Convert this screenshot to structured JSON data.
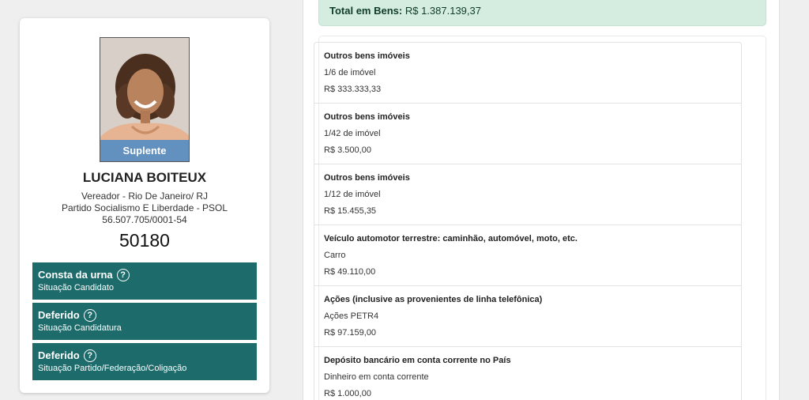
{
  "candidate": {
    "badge": "Suplente",
    "name": "LUCIANA BOITEUX",
    "office": "Vereador - Rio De Janeiro/ RJ",
    "party": "Partido Socialismo E Liberdade - PSOL",
    "cnpj": "56.507.705/0001-54",
    "number": "50180"
  },
  "status_boxes": [
    {
      "title": "Consta da urna",
      "subtitle": "Situação Candidato"
    },
    {
      "title": "Deferido",
      "subtitle": "Situação Candidatura"
    },
    {
      "title": "Deferido",
      "subtitle": "Situação Partido/Federação/Coligação"
    }
  ],
  "help_glyph": "?",
  "total": {
    "label": "Total em Bens:",
    "value": "R$ 1.387.139,37"
  },
  "assets": [
    {
      "type": "Outros bens imóveis",
      "desc": "1/6 de imóvel",
      "value": "R$ 333.333,33"
    },
    {
      "type": "Outros bens imóveis",
      "desc": "1/42 de imóvel",
      "value": "R$ 3.500,00"
    },
    {
      "type": "Outros bens imóveis",
      "desc": "1/12 de imóvel",
      "value": "R$ 15.455,35"
    },
    {
      "type": "Veículo automotor terrestre: caminhão, automóvel, moto, etc.",
      "desc": "Carro",
      "value": "R$ 49.110,00"
    },
    {
      "type": "Ações (inclusive as provenientes de linha telefônica)",
      "desc": "Ações PETR4",
      "value": "R$ 97.159,00"
    },
    {
      "type": "Depósito bancário em conta corrente no País",
      "desc": "Dinheiro em conta corrente",
      "value": "R$ 1.000,00"
    }
  ],
  "colors": {
    "status_bg": "#1e6b6b",
    "total_bg": "#d5ece0",
    "badge_bg": "#4a89c7"
  }
}
